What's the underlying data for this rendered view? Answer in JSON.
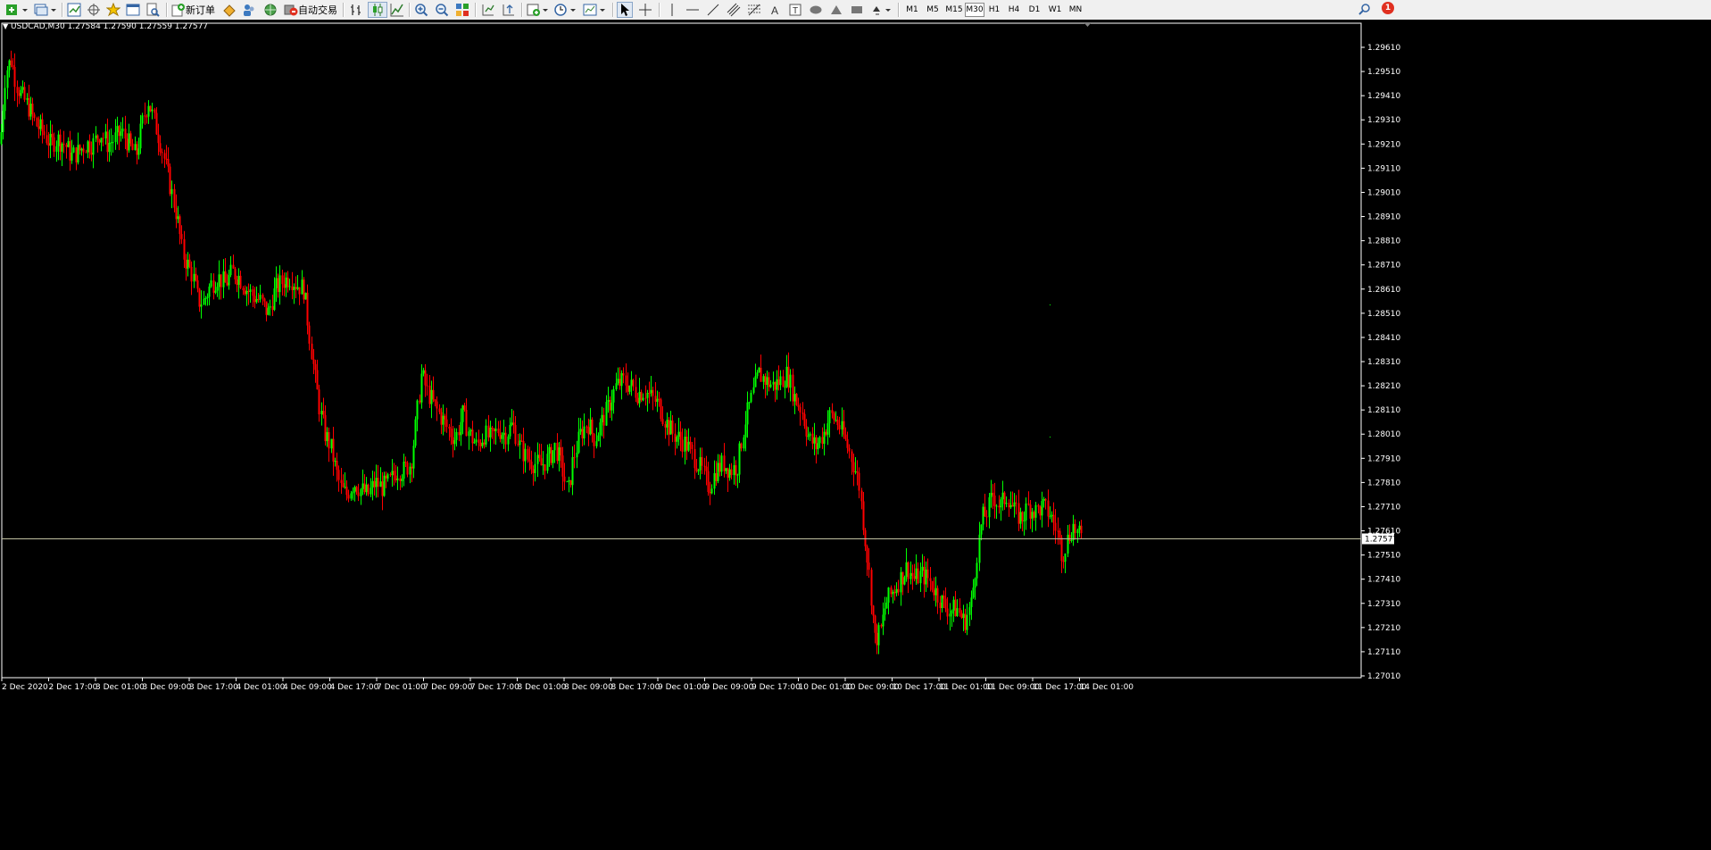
{
  "toolbar": {
    "new_order_label": "新订单",
    "auto_trading_label": "自动交易",
    "timeframes": [
      "M1",
      "M5",
      "M15",
      "M30",
      "H1",
      "H4",
      "D1",
      "W1",
      "MN"
    ],
    "active_timeframe": "M30",
    "alert_count": "1"
  },
  "chart": {
    "symbol_info": "USDCAD,M30  1.27584 1.27590 1.27559 1.27577",
    "current_price_label": "1.27577",
    "background": "#000000",
    "bull_color": "#00ff00",
    "bear_color": "#ff0000",
    "axis_text_color": "#ffffff",
    "price_line_color": "#c0c0a0"
  },
  "chart_data": {
    "type": "candlestick",
    "symbol": "USDCAD",
    "timeframe": "M30",
    "ohlc_current": {
      "open": 1.27584,
      "high": 1.2759,
      "low": 1.27559,
      "close": 1.27577
    },
    "y_ticks": [
      1.2961,
      1.2951,
      1.2941,
      1.2931,
      1.2921,
      1.2911,
      1.2901,
      1.2891,
      1.2881,
      1.2871,
      1.2861,
      1.2851,
      1.2841,
      1.2831,
      1.2821,
      1.2811,
      1.2801,
      1.2791,
      1.2781,
      1.2771,
      1.2761,
      1.2751,
      1.2741,
      1.2731,
      1.2721,
      1.2711,
      1.2701
    ],
    "y_tick_labels": [
      "1.29610",
      "1.29510",
      "1.29410",
      "1.29310",
      "1.29210",
      "1.29110",
      "1.29010",
      "1.28910",
      "1.28810",
      "1.28710",
      "1.28610",
      "1.28510",
      "1.28410",
      "1.28310",
      "1.28210",
      "1.28110",
      "1.28010",
      "1.27910",
      "1.27810",
      "1.27710",
      "1.27610",
      "1.27510",
      "1.27410",
      "1.27310",
      "1.27210",
      "1.27110",
      "1.27010"
    ],
    "x_labels": [
      "2 Dec 2020",
      "2 Dec 17:00",
      "3 Dec 01:00",
      "3 Dec 09:00",
      "3 Dec 17:00",
      "4 Dec 01:00",
      "4 Dec 09:00",
      "4 Dec 17:00",
      "7 Dec 01:00",
      "7 Dec 09:00",
      "7 Dec 17:00",
      "8 Dec 01:00",
      "8 Dec 09:00",
      "8 Dec 17:00",
      "9 Dec 01:00",
      "9 Dec 09:00",
      "9 Dec 17:00",
      "10 Dec 01:00",
      "10 Dec 09:00",
      "10 Dec 17:00",
      "11 Dec 01:00",
      "11 Dec 09:00",
      "11 Dec 17:00",
      "14 Dec 01:00"
    ],
    "current_price": 1.27577,
    "close_path": [
      [
        0,
        1.2921
      ],
      [
        6,
        1.2951
      ],
      [
        12,
        1.2956
      ],
      [
        18,
        1.2946
      ],
      [
        24,
        1.2941
      ],
      [
        32,
        1.2936
      ],
      [
        40,
        1.2929
      ],
      [
        48,
        1.2926
      ],
      [
        56,
        1.2921
      ],
      [
        64,
        1.2923
      ],
      [
        72,
        1.2921
      ],
      [
        80,
        1.2916
      ],
      [
        88,
        1.2918
      ],
      [
        96,
        1.2921
      ],
      [
        104,
        1.2921
      ],
      [
        112,
        1.2926
      ],
      [
        120,
        1.2921
      ],
      [
        128,
        1.2923
      ],
      [
        136,
        1.2926
      ],
      [
        144,
        1.2921
      ],
      [
        152,
        1.2916
      ],
      [
        160,
        1.2931
      ],
      [
        166,
        1.2939
      ],
      [
        172,
        1.2931
      ],
      [
        180,
        1.2921
      ],
      [
        186,
        1.2911
      ],
      [
        192,
        1.2901
      ],
      [
        198,
        1.2891
      ],
      [
        204,
        1.2876
      ],
      [
        210,
        1.2871
      ],
      [
        216,
        1.2866
      ],
      [
        222,
        1.2856
      ],
      [
        228,
        1.2856
      ],
      [
        236,
        1.2863
      ],
      [
        244,
        1.2866
      ],
      [
        252,
        1.2863
      ],
      [
        260,
        1.2868
      ],
      [
        268,
        1.2866
      ],
      [
        276,
        1.2861
      ],
      [
        284,
        1.2858
      ],
      [
        292,
        1.2856
      ],
      [
        300,
        1.2851
      ],
      [
        308,
        1.2861
      ],
      [
        316,
        1.2864
      ],
      [
        324,
        1.2866
      ],
      [
        332,
        1.2863
      ],
      [
        340,
        1.2861
      ],
      [
        346,
        1.2843
      ],
      [
        352,
        1.2826
      ],
      [
        358,
        1.2811
      ],
      [
        364,
        1.2801
      ],
      [
        370,
        1.2796
      ],
      [
        376,
        1.2786
      ],
      [
        382,
        1.2778
      ],
      [
        388,
        1.2776
      ],
      [
        396,
        1.2781
      ],
      [
        404,
        1.2778
      ],
      [
        412,
        1.2776
      ],
      [
        420,
        1.2781
      ],
      [
        428,
        1.2779
      ],
      [
        436,
        1.2781
      ],
      [
        444,
        1.2786
      ],
      [
        452,
        1.2786
      ],
      [
        460,
        1.2789
      ],
      [
        466,
        1.2806
      ],
      [
        472,
        1.2826
      ],
      [
        478,
        1.2819
      ],
      [
        486,
        1.2813
      ],
      [
        494,
        1.2808
      ],
      [
        502,
        1.2803
      ],
      [
        510,
        1.2799
      ],
      [
        518,
        1.2809
      ],
      [
        526,
        1.2801
      ],
      [
        534,
        1.2796
      ],
      [
        542,
        1.2801
      ],
      [
        550,
        1.2799
      ],
      [
        558,
        1.2803
      ],
      [
        566,
        1.2801
      ],
      [
        574,
        1.2805
      ],
      [
        582,
        1.2796
      ],
      [
        590,
        1.2791
      ],
      [
        598,
        1.2789
      ],
      [
        606,
        1.2788
      ],
      [
        614,
        1.2791
      ],
      [
        622,
        1.2796
      ],
      [
        630,
        1.2786
      ],
      [
        636,
        1.2776
      ],
      [
        642,
        1.2791
      ],
      [
        650,
        1.2801
      ],
      [
        658,
        1.2806
      ],
      [
        666,
        1.2799
      ],
      [
        674,
        1.2806
      ],
      [
        682,
        1.2813
      ],
      [
        690,
        1.2821
      ],
      [
        698,
        1.2823
      ],
      [
        706,
        1.2821
      ],
      [
        714,
        1.2818
      ],
      [
        722,
        1.2819
      ],
      [
        730,
        1.2816
      ],
      [
        738,
        1.2813
      ],
      [
        746,
        1.2806
      ],
      [
        754,
        1.2801
      ],
      [
        762,
        1.2799
      ],
      [
        770,
        1.2796
      ],
      [
        778,
        1.2791
      ],
      [
        786,
        1.2786
      ],
      [
        794,
        1.2779
      ],
      [
        802,
        1.2786
      ],
      [
        810,
        1.2789
      ],
      [
        818,
        1.2786
      ],
      [
        826,
        1.2788
      ],
      [
        834,
        1.2806
      ],
      [
        842,
        1.2816
      ],
      [
        850,
        1.2826
      ],
      [
        858,
        1.2823
      ],
      [
        866,
        1.2821
      ],
      [
        874,
        1.2823
      ],
      [
        882,
        1.2826
      ],
      [
        890,
        1.2816
      ],
      [
        898,
        1.2811
      ],
      [
        906,
        1.2799
      ],
      [
        914,
        1.2796
      ],
      [
        922,
        1.2801
      ],
      [
        930,
        1.2809
      ],
      [
        938,
        1.2806
      ],
      [
        946,
        1.2799
      ],
      [
        954,
        1.2791
      ],
      [
        962,
        1.2781
      ],
      [
        968,
        1.2761
      ],
      [
        974,
        1.2741
      ],
      [
        980,
        1.2716
      ],
      [
        986,
        1.2719
      ],
      [
        992,
        1.2731
      ],
      [
        1000,
        1.2736
      ],
      [
        1008,
        1.2741
      ],
      [
        1016,
        1.2746
      ],
      [
        1024,
        1.2741
      ],
      [
        1032,
        1.2743
      ],
      [
        1040,
        1.2741
      ],
      [
        1048,
        1.2736
      ],
      [
        1056,
        1.2731
      ],
      [
        1064,
        1.2728
      ],
      [
        1072,
        1.2729
      ],
      [
        1080,
        1.2723
      ],
      [
        1088,
        1.2731
      ],
      [
        1094,
        1.2751
      ],
      [
        1100,
        1.2766
      ],
      [
        1106,
        1.2769
      ],
      [
        1112,
        1.2776
      ],
      [
        1120,
        1.2771
      ],
      [
        1128,
        1.2776
      ],
      [
        1136,
        1.2769
      ],
      [
        1144,
        1.2766
      ],
      [
        1152,
        1.2771
      ],
      [
        1160,
        1.2769
      ],
      [
        1168,
        1.2771
      ],
      [
        1176,
        1.2768
      ],
      [
        1184,
        1.2761
      ],
      [
        1190,
        1.2751
      ],
      [
        1196,
        1.2758
      ],
      [
        1202,
        1.2763
      ],
      [
        1208,
        1.2759
      ],
      [
        1212,
        1.27577
      ]
    ]
  }
}
